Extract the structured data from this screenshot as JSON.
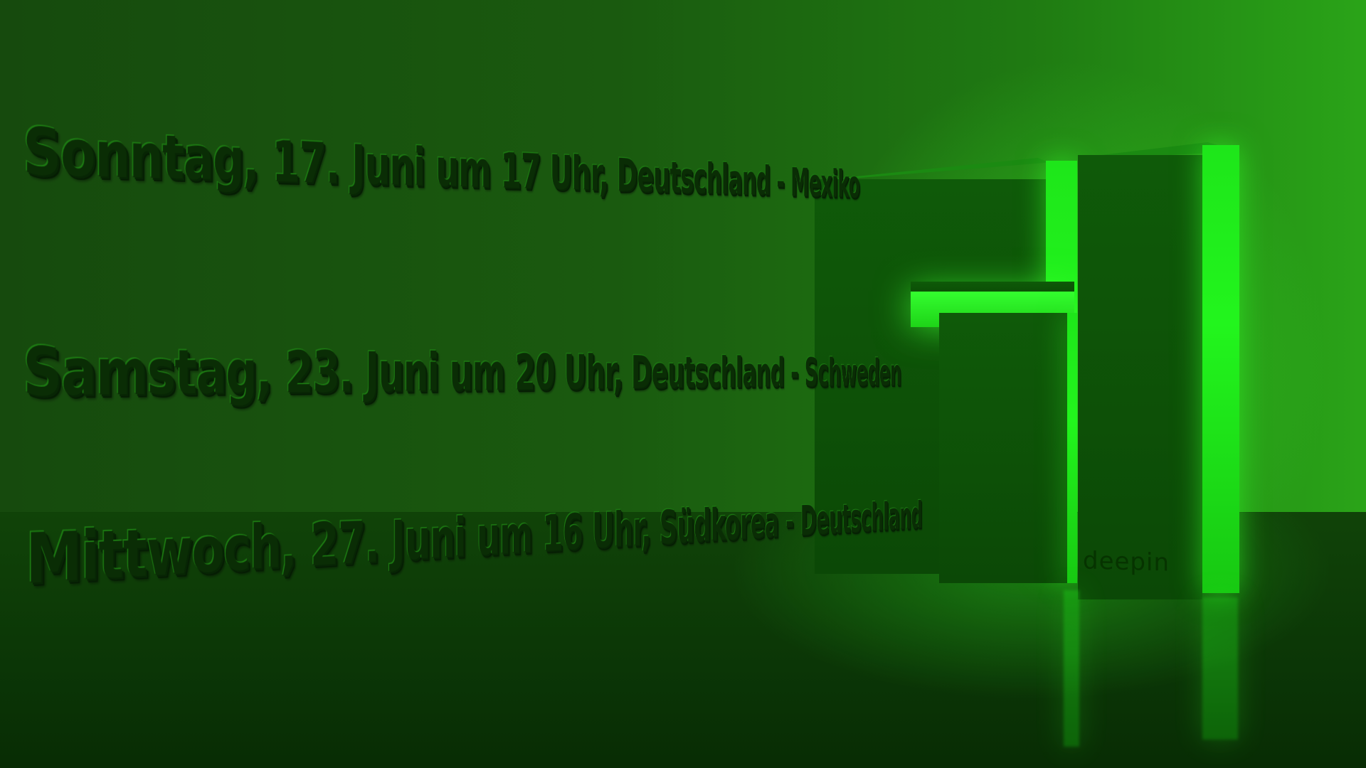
{
  "wallpaper": {
    "accent_color": "#22f51d",
    "background_color": "#1a5a0f",
    "logo": {
      "icon": "deepin-logo-icon",
      "text": "deepin"
    }
  },
  "schedule": [
    {
      "text": "Sonntag, 17. Juni um 17 Uhr, Deutschland - Mexiko"
    },
    {
      "text": "Samstag, 23. Juni um 20 Uhr, Deutschland - Schweden"
    },
    {
      "text": "Mittwoch, 27. Juni um 16 Uhr, Südkorea - Deutschland"
    }
  ]
}
